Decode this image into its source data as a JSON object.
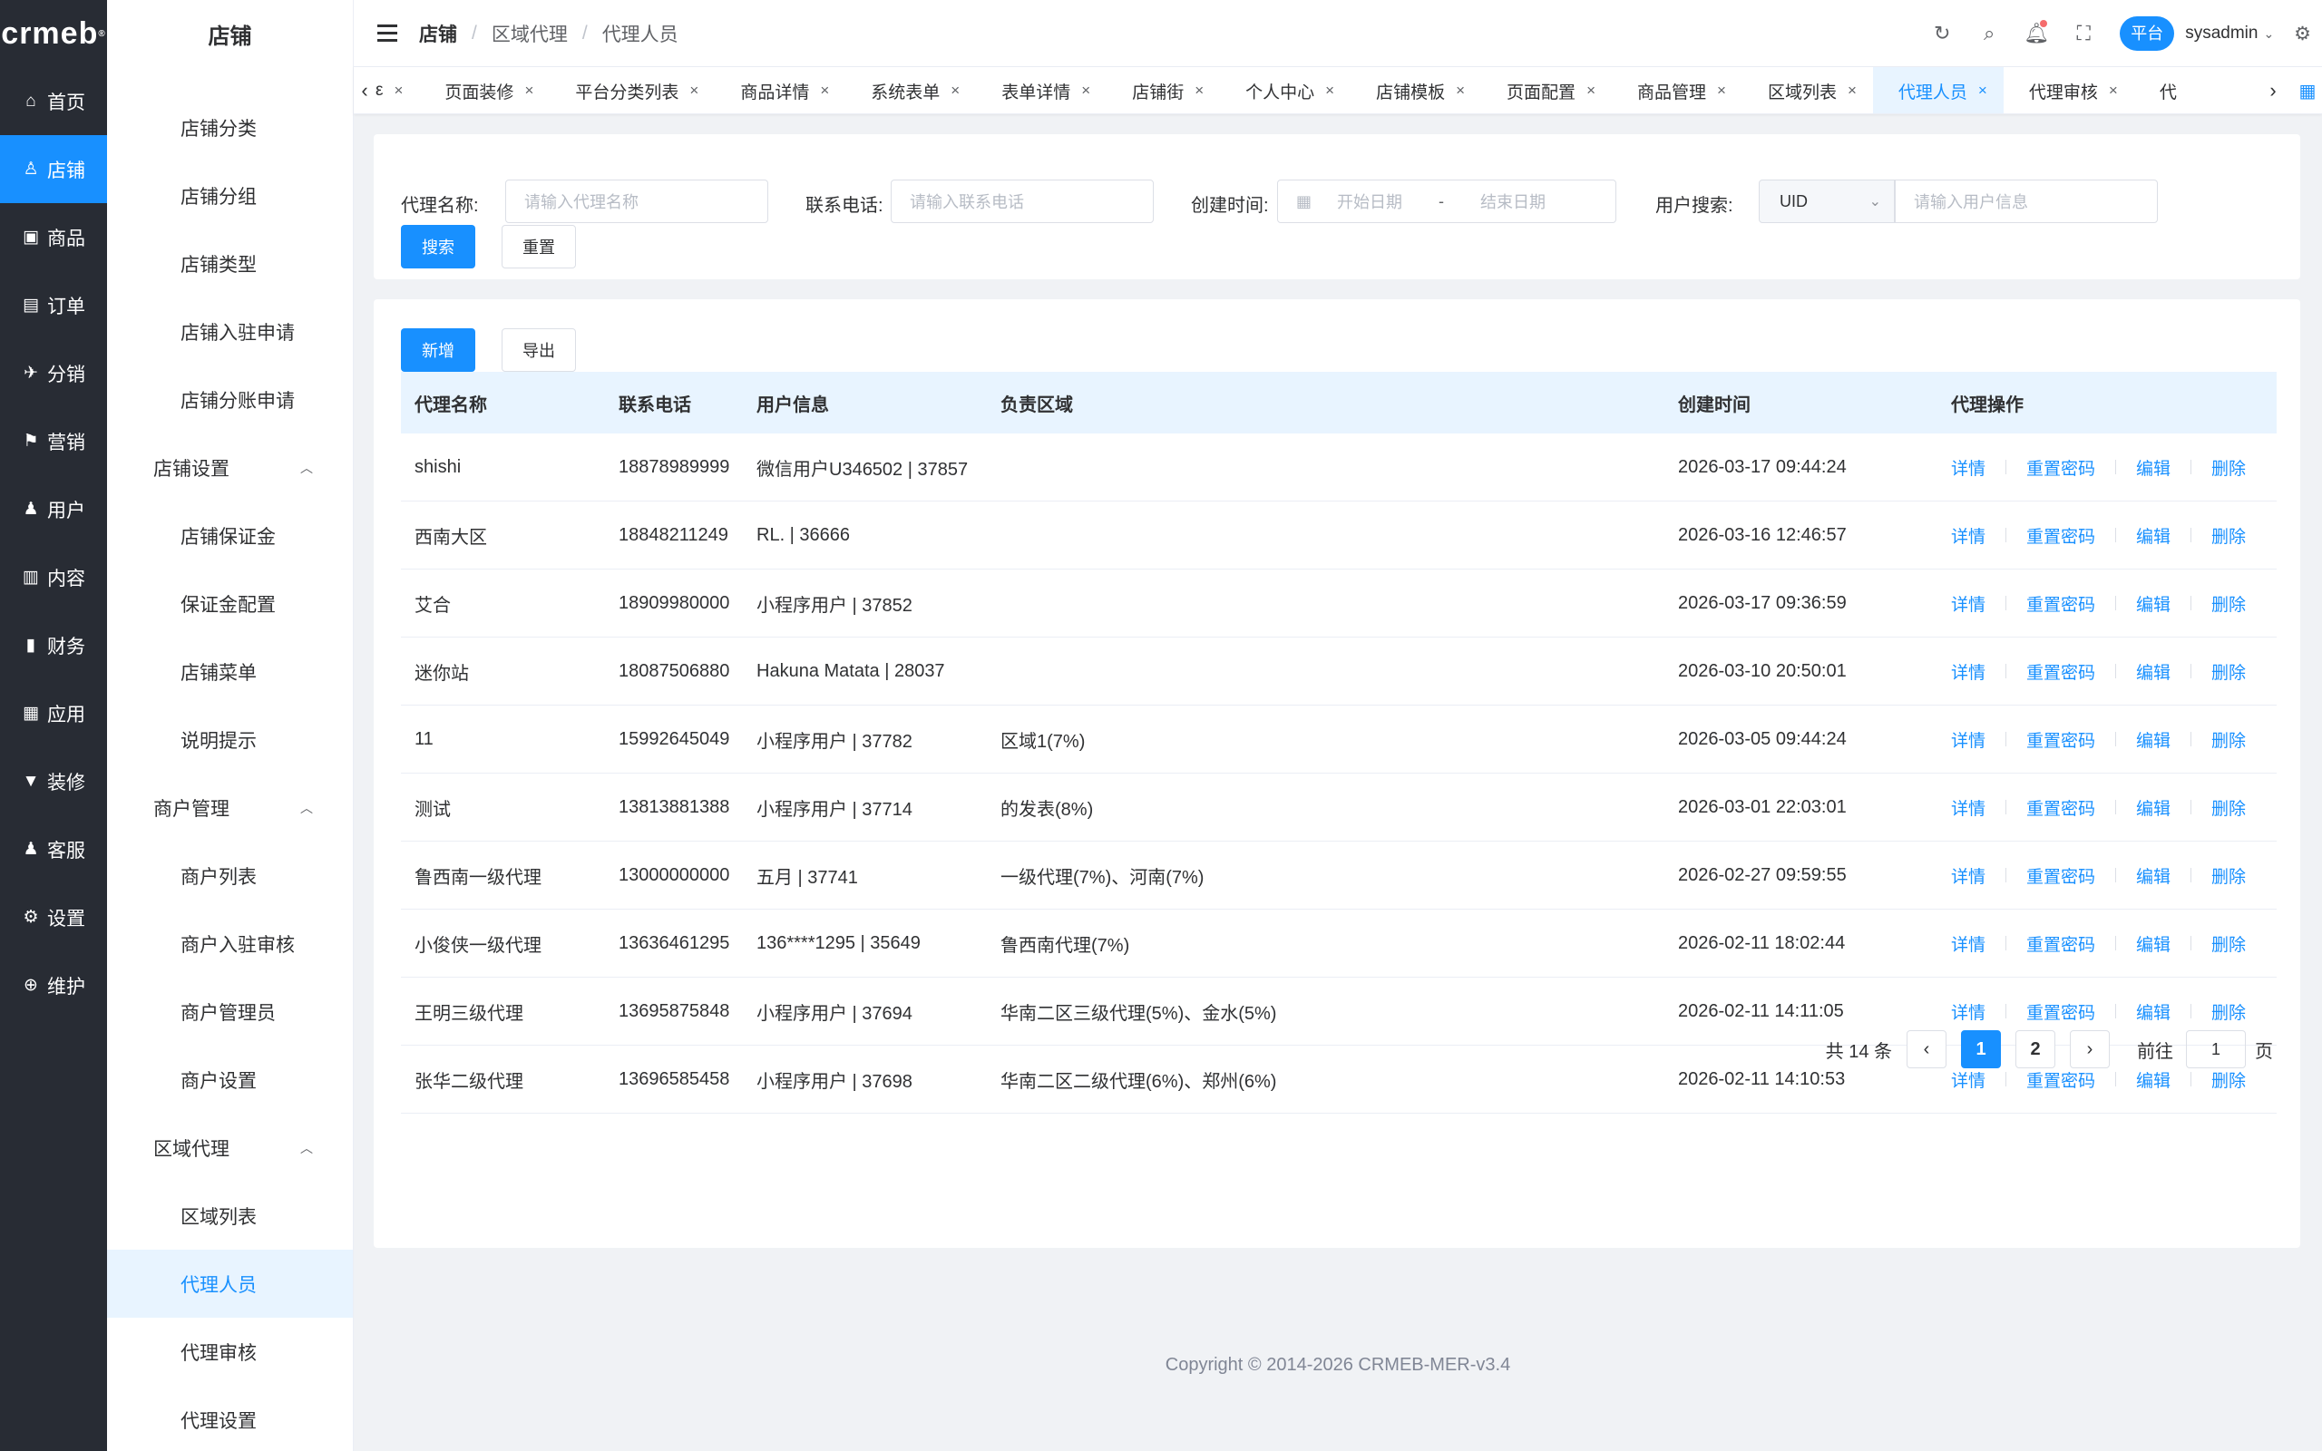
{
  "brand": {
    "logo": "crmeb",
    "logo_mark": "®"
  },
  "rail": [
    {
      "label": "首页",
      "icon": "⌂",
      "active": false
    },
    {
      "label": "店铺",
      "icon": "♙",
      "active": true
    },
    {
      "label": "商品",
      "icon": "▣",
      "active": false
    },
    {
      "label": "订单",
      "icon": "▤",
      "active": false
    },
    {
      "label": "分销",
      "icon": "✈",
      "active": false
    },
    {
      "label": "营销",
      "icon": "⚑",
      "active": false
    },
    {
      "label": "用户",
      "icon": "♟",
      "active": false
    },
    {
      "label": "内容",
      "icon": "▥",
      "active": false
    },
    {
      "label": "财务",
      "icon": "▮",
      "active": false
    },
    {
      "label": "应用",
      "icon": "▦",
      "active": false
    },
    {
      "label": "装修",
      "icon": "▼",
      "active": false
    },
    {
      "label": "客服",
      "icon": "♟",
      "active": false
    },
    {
      "label": "设置",
      "icon": "⚙",
      "active": false
    },
    {
      "label": "维护",
      "icon": "⊕",
      "active": false
    }
  ],
  "sidebar": {
    "title": "店铺",
    "items": [
      {
        "type": "item",
        "label": "店铺分类"
      },
      {
        "type": "item",
        "label": "店铺分组"
      },
      {
        "type": "item",
        "label": "店铺类型"
      },
      {
        "type": "item",
        "label": "店铺入驻申请"
      },
      {
        "type": "item",
        "label": "店铺分账申请"
      },
      {
        "type": "group",
        "label": "店铺设置"
      },
      {
        "type": "item",
        "label": "店铺保证金"
      },
      {
        "type": "item",
        "label": "保证金配置"
      },
      {
        "type": "item",
        "label": "店铺菜单"
      },
      {
        "type": "item",
        "label": "说明提示"
      },
      {
        "type": "group",
        "label": "商户管理"
      },
      {
        "type": "item",
        "label": "商户列表"
      },
      {
        "type": "item",
        "label": "商户入驻审核"
      },
      {
        "type": "item",
        "label": "商户管理员"
      },
      {
        "type": "item",
        "label": "商户设置"
      },
      {
        "type": "group",
        "label": "区域代理"
      },
      {
        "type": "item",
        "label": "区域列表"
      },
      {
        "type": "item",
        "label": "代理人员",
        "active": true
      },
      {
        "type": "item",
        "label": "代理审核"
      },
      {
        "type": "item",
        "label": "代理设置"
      }
    ]
  },
  "header": {
    "breadcrumb": [
      "店铺",
      "区域代理",
      "代理人员"
    ],
    "platform_badge": "平台",
    "username": "sysadmin"
  },
  "tags": [
    {
      "label": "ε",
      "first": true
    },
    {
      "label": "页面装修"
    },
    {
      "label": "平台分类列表"
    },
    {
      "label": "商品详情"
    },
    {
      "label": "系统表单"
    },
    {
      "label": "表单详情"
    },
    {
      "label": "店铺街"
    },
    {
      "label": "个人中心"
    },
    {
      "label": "店铺模板"
    },
    {
      "label": "页面配置"
    },
    {
      "label": "商品管理"
    },
    {
      "label": "区域列表"
    },
    {
      "label": "代理人员",
      "active": true
    },
    {
      "label": "代理审核"
    },
    {
      "label": "代"
    }
  ],
  "filter": {
    "name_label": "代理名称:",
    "name_placeholder": "请输入代理名称",
    "phone_label": "联系电话:",
    "phone_placeholder": "请输入联系电话",
    "time_label": "创建时间:",
    "start_placeholder": "开始日期",
    "date_sep": "-",
    "end_placeholder": "结束日期",
    "user_label": "用户搜索:",
    "user_select": "UID",
    "user_placeholder": "请输入用户信息",
    "search_btn": "搜索",
    "reset_btn": "重置"
  },
  "toolbar": {
    "add_btn": "新增",
    "export_btn": "导出"
  },
  "table": {
    "columns": [
      "代理名称",
      "联系电话",
      "用户信息",
      "负责区域",
      "创建时间",
      "代理操作"
    ],
    "ops": [
      "详情",
      "重置密码",
      "编辑",
      "删除"
    ],
    "rows": [
      {
        "name": "shishi",
        "phone": "18878989999",
        "user": "微信用户U346502 | 37857",
        "region": "",
        "created": "2026-03-17 09:44:24"
      },
      {
        "name": "西南大区",
        "phone": "18848211249",
        "user": "RL. | 36666",
        "region": "",
        "created": "2026-03-16 12:46:57"
      },
      {
        "name": "艾合",
        "phone": "18909980000",
        "user": "小程序用户 | 37852",
        "region": "",
        "created": "2026-03-17 09:36:59"
      },
      {
        "name": "迷你站",
        "phone": "18087506880",
        "user": "Hakuna Matata | 28037",
        "region": "",
        "created": "2026-03-10 20:50:01"
      },
      {
        "name": "11",
        "phone": "15992645049",
        "user": "小程序用户 | 37782",
        "region": "区域1(7%)",
        "created": "2026-03-05 09:44:24"
      },
      {
        "name": "测试",
        "phone": "13813881388",
        "user": "小程序用户 | 37714",
        "region": "的发表(8%)",
        "created": "2026-03-01 22:03:01"
      },
      {
        "name": "鲁西南一级代理",
        "phone": "13000000000",
        "user": "五月 | 37741",
        "region": "一级代理(7%)、河南(7%)",
        "created": "2026-02-27 09:59:55"
      },
      {
        "name": "小俊侠一级代理",
        "phone": "13636461295",
        "user": "136****1295 | 35649",
        "region": "鲁西南代理(7%)",
        "created": "2026-02-11 18:02:44"
      },
      {
        "name": "王明三级代理",
        "phone": "13695875848",
        "user": "小程序用户 | 37694",
        "region": "华南二区三级代理(5%)、金水(5%)",
        "created": "2026-02-11 14:11:05"
      },
      {
        "name": "张华二级代理",
        "phone": "13696585458",
        "user": "小程序用户 | 37698",
        "region": "华南二区二级代理(6%)、郑州(6%)",
        "created": "2026-02-11 14:10:53"
      }
    ]
  },
  "pagination": {
    "total_text": "共 14 条",
    "pages": [
      "1",
      "2"
    ],
    "current": "1",
    "goto_label": "前往",
    "goto_value": "1",
    "page_suffix": "页"
  },
  "footer": "Copyright © 2014-2026 CRMEB-MER-v3.4",
  "colors": {
    "primary": "#1890ff",
    "rail_bg": "#282c34",
    "active_bg": "#e8f4ff"
  }
}
